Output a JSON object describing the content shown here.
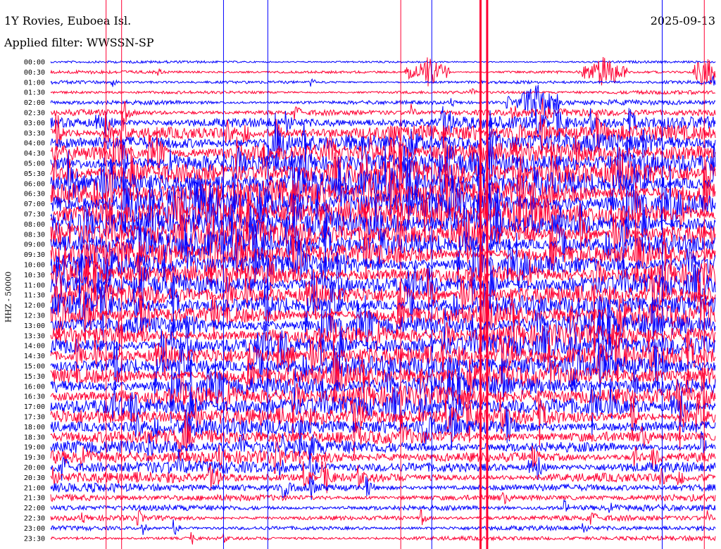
{
  "header": {
    "station": "1Y Rovies, Euboea Isl.",
    "date": "2025-09-13",
    "filter": "Applied filter: WWSSN-SP"
  },
  "chart_data": {
    "type": "line",
    "title": "1Y Rovies, Euboea Isl.",
    "ylabel": "HHZ - 50000",
    "row_labels": [
      "00:00",
      "00:30",
      "01:00",
      "01:30",
      "02:00",
      "02:30",
      "03:00",
      "03:30",
      "04:00",
      "04:30",
      "05:00",
      "05:30",
      "06:00",
      "06:30",
      "07:00",
      "07:30",
      "08:00",
      "08:30",
      "09:00",
      "09:30",
      "10:00",
      "10:30",
      "11:00",
      "11:30",
      "12:00",
      "12:30",
      "13:00",
      "13:30",
      "14:00",
      "14:30",
      "15:00",
      "15:30",
      "16:00",
      "16:30",
      "17:00",
      "17:30",
      "18:00",
      "18:30",
      "19:00",
      "19:30",
      "20:00",
      "20:30",
      "21:00",
      "21:30",
      "22:00",
      "22:30",
      "23:00",
      "23:30"
    ],
    "row_minutes": 30,
    "series_colors": [
      "#0000ff",
      "#ff0033"
    ],
    "noise_level": [
      0.35,
      0.45,
      0.5,
      0.5,
      0.7,
      1.0,
      1.8,
      2.2,
      2.5,
      2.8,
      3.0,
      3.2,
      3.4,
      3.6,
      3.6,
      3.5,
      3.6,
      3.5,
      3.4,
      3.3,
      3.2,
      3.2,
      3.1,
      3.0,
      3.0,
      3.0,
      3.0,
      2.9,
      2.9,
      2.8,
      2.8,
      2.8,
      2.7,
      2.7,
      2.6,
      2.4,
      2.2,
      2.0,
      1.9,
      1.8,
      1.7,
      1.5,
      1.2,
      1.0,
      0.9,
      0.8,
      0.7,
      0.6
    ],
    "events": [
      {
        "row": 1,
        "minute_start": 16.0,
        "minute_end": 18.0,
        "amplitude": 3.5
      },
      {
        "row": 1,
        "minute_start": 24.0,
        "minute_end": 26.0,
        "amplitude": 3.5
      },
      {
        "row": 1,
        "minute_start": 29.0,
        "minute_end": 30.0,
        "amplitude": 4.5
      },
      {
        "row": 4,
        "minute_start": 21.0,
        "minute_end": 23.0,
        "amplitude": 4.0
      },
      {
        "row": 14,
        "minute_start": 5.0,
        "minute_end": 8.0,
        "amplitude": 4.5
      },
      {
        "row": 15,
        "minute_start": 20.0,
        "minute_end": 23.0,
        "amplitude": 4.0
      }
    ],
    "spikes": [
      {
        "minute": 2.5,
        "color": "red"
      },
      {
        "minute": 3.2,
        "color": "red"
      },
      {
        "minute": 7.8,
        "color": "blue"
      },
      {
        "minute": 9.8,
        "color": "blue"
      },
      {
        "minute": 15.8,
        "color": "red"
      },
      {
        "minute": 17.2,
        "color": "blue"
      },
      {
        "minute": 19.4,
        "color": "red"
      },
      {
        "minute": 19.7,
        "color": "red"
      },
      {
        "minute": 27.6,
        "color": "blue"
      },
      {
        "minute": 29.5,
        "color": "red"
      }
    ]
  }
}
